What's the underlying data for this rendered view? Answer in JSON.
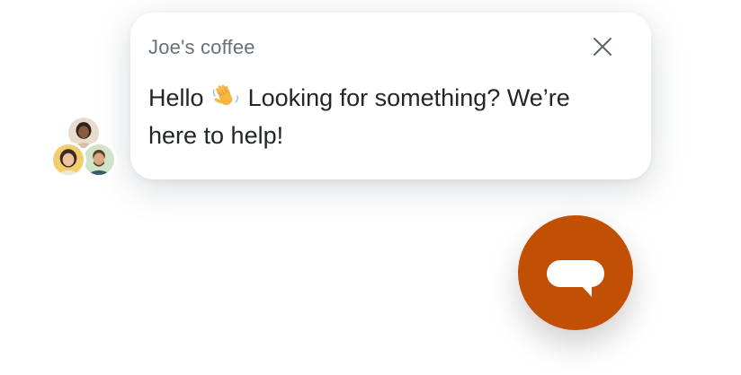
{
  "widget": {
    "title": "Joe's coffee",
    "message_before": "Hello",
    "message_after": "Looking for something? We’re here to help!",
    "wave_icon": "waving-hand-icon",
    "close_icon": "close-icon",
    "launcher_icon": "chat-bubble-icon"
  },
  "colors": {
    "launcher": "#c15004",
    "title": "#67707a",
    "text": "#22262b"
  }
}
